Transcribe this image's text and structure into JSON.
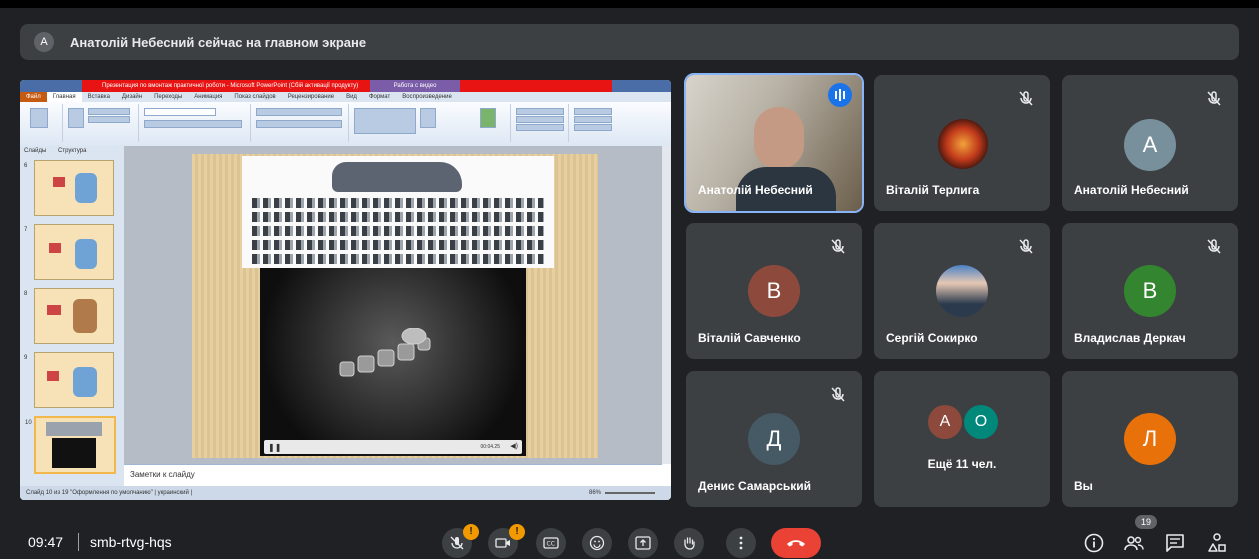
{
  "banner": {
    "avatar_letter": "A",
    "text": "Анатолій Небесний сейчас на главном экране"
  },
  "presentation": {
    "title_bar": "Презентация по вмонтаж практичної роботи - Microsoft PowerPoint (Сбій активації продукту)",
    "work_label": "Работа с видео",
    "tabs": [
      "Файл",
      "Главная",
      "Вставка",
      "Дизайн",
      "Переходы",
      "Анимация",
      "Показ слайдов",
      "Рецензирование",
      "Вид",
      "Формат",
      "Воспроизведение"
    ],
    "panel_tabs": [
      "Слайды",
      "Структура"
    ],
    "thumb_numbers": [
      "6",
      "7",
      "8",
      "9",
      "10"
    ],
    "notes_placeholder": "Заметки к слайду",
    "status_text": "Слайд 10 из 19  \"Оформлення по умолчанию\"  | украинский |",
    "zoom": "86%",
    "video_time": "00:04.25"
  },
  "tiles": [
    {
      "name": "Анатолій Небесний",
      "type": "video",
      "speaking": true
    },
    {
      "name": "Віталій Терлига",
      "type": "photo",
      "muted": true
    },
    {
      "name": "Анатолій Небесний",
      "type": "letter",
      "letter": "A",
      "color": "#78909c",
      "muted": true
    },
    {
      "name": "Віталій Савченко",
      "type": "letter",
      "letter": "B",
      "color": "#8d4a3c",
      "muted": true
    },
    {
      "name": "Сергій Сокирко",
      "type": "photo",
      "muted": true
    },
    {
      "name": "Владислав Деркач",
      "type": "letter",
      "letter": "B",
      "color": "#33862f",
      "muted": true
    },
    {
      "name": "Денис Самарський",
      "type": "letter",
      "letter": "Д",
      "color": "#455a64",
      "muted": true
    },
    {
      "name": "Ещё 11 чел.",
      "type": "group",
      "letters": [
        "A",
        "O"
      ],
      "colors": [
        "#8d4a3c",
        "#00897b"
      ]
    },
    {
      "name": "Вы",
      "type": "letter",
      "letter": "Л",
      "color": "#e8710a"
    }
  ],
  "footer": {
    "time": "09:47",
    "meeting_code": "smb-rtvg-hqs",
    "participants_count": "19",
    "badge": "!"
  },
  "colors": {
    "bg": "#202124",
    "tile": "#3c4043",
    "end_call": "#ea4335",
    "speaking": "#1a73e8",
    "alert": "#f29900"
  }
}
